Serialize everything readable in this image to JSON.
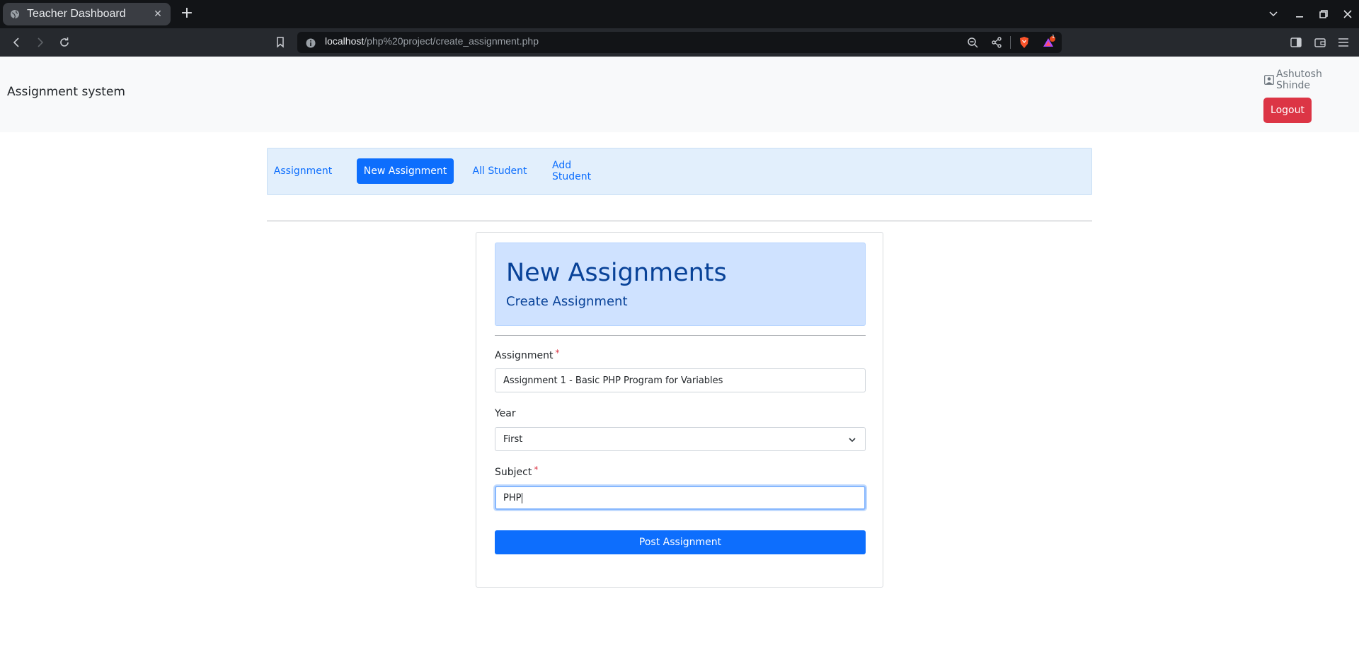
{
  "browser": {
    "tab_title": "Teacher Dashboard",
    "new_tab": "+",
    "url_host": "localhost",
    "url_path": "/php%20project/create_assignment.php",
    "shield_badge": "1"
  },
  "header": {
    "brand": "Assignment system",
    "user_name": "Ashutosh Shinde",
    "logout_label": "Logout"
  },
  "nav": {
    "items": [
      {
        "label": "Assignment",
        "active": false
      },
      {
        "label": "New Assignment",
        "active": true
      },
      {
        "label": "All Student",
        "active": false
      },
      {
        "label": "Add Student",
        "active": false
      }
    ]
  },
  "form": {
    "title": "New Assignments",
    "subtitle": "Create Assignment",
    "assignment": {
      "label": "Assignment",
      "required": "*",
      "value": "Assignment 1 - Basic PHP Program for Variables"
    },
    "year": {
      "label": "Year",
      "value": "First"
    },
    "subject": {
      "label": "Subject",
      "required": "*",
      "value": "PHP"
    },
    "submit_label": "Post Assignment"
  },
  "colors": {
    "primary": "#0d6efd",
    "danger": "#dc3545",
    "nav_bg": "#e2effc",
    "jumbo_bg": "#cfe2ff"
  }
}
